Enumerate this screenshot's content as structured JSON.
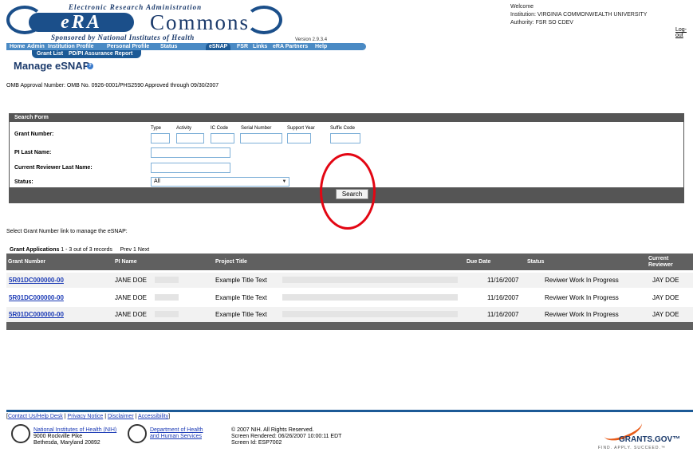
{
  "logo": {
    "topline": "Electronic Research Administration",
    "era": "eRA",
    "commons": "Commons",
    "sponsored": "Sponsored by National Institutes of Health",
    "version": "Version 2.9.3.4"
  },
  "welcome": {
    "line1": "Welcome",
    "institution": "Institution: VIRGINIA COMMONWEALTH UNIVERSITY",
    "authority": "Authority:  FSR SO CDEV",
    "logout": "Log-out"
  },
  "nav": {
    "items": [
      "Home",
      "Admin",
      "Institution Profile",
      "Personal Profile",
      "Status",
      "eSNAP",
      "FSR",
      "Links",
      "eRA Partners",
      "Help"
    ],
    "active": "eSNAP",
    "subitems": [
      "Grant List",
      "PD/PI Assurance Report"
    ]
  },
  "page": {
    "title": "Manage eSNAP",
    "help_icon": "help-icon",
    "omb": "OMB Approval Number: OMB No. 0926-0001/PHS2590 Approved through 09/30/2007"
  },
  "search_form": {
    "header": "Search Form",
    "grant_number_label": "Grant Number:",
    "sublabels": [
      "Type",
      "Activity",
      "IC Code",
      "Serial Number",
      "Support Year",
      "Suffix Code"
    ],
    "pi_last_name_label": "PI Last Name:",
    "reviewer_label": "Current Reviewer Last Name:",
    "status_label": "Status:",
    "status_value": "All",
    "search_button": "Search"
  },
  "select_note": "Select Grant Number link to manage the eSNAP:",
  "grants": {
    "caption_bold": "Grant Applications",
    "caption_rest": " 1 - 3 out of 3 records",
    "pager": "Prev 1 Next",
    "columns": [
      "Grant Number",
      "PI Name",
      "Project Title",
      "Due Date",
      "Status",
      "Current",
      "Reviewer"
    ],
    "rows": [
      {
        "grant": "5R01DC000000-00",
        "pi": "JANE DOE",
        "title": "Example Title Text",
        "due": "11/16/2007",
        "status": "Reviwer Work In Progress",
        "reviewer": "JAY DOE"
      },
      {
        "grant": "5R01DC000000-00",
        "pi": "JANE DOE",
        "title": "Example Title Text",
        "due": "11/16/2007",
        "status": "Reviwer Work In Progress",
        "reviewer": "JAY DOE"
      },
      {
        "grant": "5R01DC000000-00",
        "pi": "JANE DOE",
        "title": "Example Title Text",
        "due": "11/16/2007",
        "status": "Reviwer Work In Progress",
        "reviewer": "JAY DOE"
      }
    ]
  },
  "footer": {
    "bracket_open": "[",
    "links": [
      "Contact Us/Help Desk",
      "Privacy Notice",
      "Disclaimer",
      "Accessibility"
    ],
    "sep": " | ",
    "bracket_close": "]",
    "nih_name": "National Institutes of Health (NIH)",
    "nih_addr1": "9000 Rockville Pike",
    "nih_addr2": "Bethesda, Maryland 20892",
    "hhs_line1": "Department of Health",
    "hhs_line2": "and Human Services",
    "copyright": "© 2007 NIH. All Rights Reserved.",
    "rendered": "Screen Rendered: 06/26/2007 10:00:11 EDT",
    "screen_id": "Screen Id: ESP7002",
    "grants_gov": "GRANTS.GOV™",
    "grants_tag": "FIND. APPLY. SUCCEED.™"
  }
}
